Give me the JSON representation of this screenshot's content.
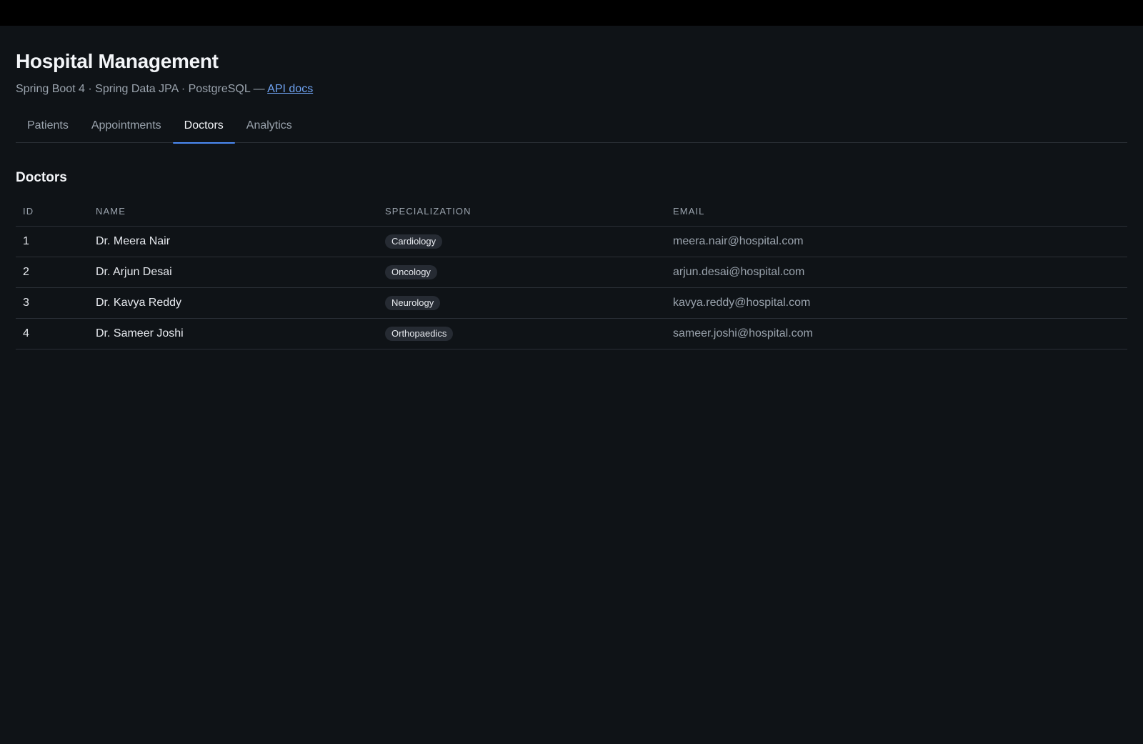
{
  "app": {
    "title": "Hospital Management",
    "subtitle_text": "Spring Boot 4 · Spring Data JPA · PostgreSQL — ",
    "api_link": "API docs"
  },
  "tabs": [
    {
      "label": "Patients",
      "active": false
    },
    {
      "label": "Appointments",
      "active": false
    },
    {
      "label": "Doctors",
      "active": true
    },
    {
      "label": "Analytics",
      "active": false
    }
  ],
  "section": {
    "title": "Doctors"
  },
  "table": {
    "headers": [
      "ID",
      "NAME",
      "SPECIALIZATION",
      "EMAIL"
    ],
    "rows": [
      {
        "id": "1",
        "name": "Dr. Meera Nair",
        "specialization": "Cardiology",
        "email": "meera.nair@hospital.com"
      },
      {
        "id": "2",
        "name": "Dr. Arjun Desai",
        "specialization": "Oncology",
        "email": "arjun.desai@hospital.com"
      },
      {
        "id": "3",
        "name": "Dr. Kavya Reddy",
        "specialization": "Neurology",
        "email": "kavya.reddy@hospital.com"
      },
      {
        "id": "4",
        "name": "Dr. Sameer Joshi",
        "specialization": "Orthopaedics",
        "email": "sameer.joshi@hospital.com"
      }
    ]
  },
  "colors": {
    "background": "#0f1317",
    "accent": "#4c8bf5",
    "link": "#6fa3f2"
  }
}
